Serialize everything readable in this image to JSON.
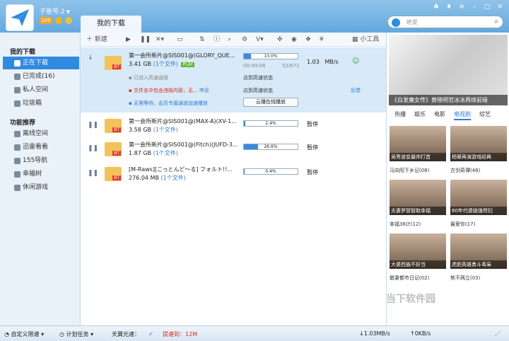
{
  "account": {
    "name": "子账号:2",
    "level": "LV5"
  },
  "tab_title": "我的下载",
  "search": {
    "placeholder": "绝爱"
  },
  "sidebar": {
    "section1": "我的下载",
    "items": [
      {
        "label": "正在下载"
      },
      {
        "label": "已完成(16)"
      },
      {
        "label": "私人空间"
      },
      {
        "label": "垃圾箱"
      }
    ],
    "section2": "功能推荐",
    "features": [
      {
        "label": "离线空间"
      },
      {
        "label": "迅雷看看"
      },
      {
        "label": "155导航"
      },
      {
        "label": "幸福树"
      },
      {
        "label": "休闲游戏"
      }
    ]
  },
  "toolbar": {
    "new_label": "新建",
    "tools_label": "小工具"
  },
  "downloads": [
    {
      "name": "第一会所新片@SIS001@(GLORY_QUE...",
      "size": "3.41 GB",
      "files": "(1个文件)",
      "progress_text": "13.0%",
      "progress": 0.13,
      "speed": "1.03",
      "speed_unit": "MB/s",
      "time": "00:49:08",
      "peers": "52/671"
    },
    {
      "name": "第一会所新片@SIS001@(MAX-A)(XV-1...",
      "size": "3.58 GB",
      "files": "(1个文件)",
      "progress_text": "2.4%",
      "progress": 0.024,
      "status": "暂停"
    },
    {
      "name": "第一会所新片@SIS001@(Fitch)(JUFD-3...",
      "size": "1.87 GB",
      "files": "(1个文件)",
      "progress_text": "26.6%",
      "progress": 0.266,
      "status": "暂停"
    },
    {
      "name": "[M-Raws][こっとんど～る] フォルト!!...",
      "size": "276.04 MB",
      "files": "(1个文件)",
      "progress_text": "0.4%",
      "progress": 0.004,
      "status": "暂停"
    }
  ],
  "details": {
    "line1": "已进入高速通道",
    "line1_status": "达到高速状态",
    "line2": "文件名中包含违规内容，无...",
    "line2_link": "申诉",
    "line2_status": "达到高速状态",
    "line3": "无需等待，会员专属通道加速播放",
    "cloud_button": "云播在线播放",
    "play": "PLAY",
    "feedback": "反馈"
  },
  "right_panel": {
    "poster_title": "《白发魔女传》黄晓明范冰冰再续前缘",
    "tabs": [
      "热播",
      "娱乐",
      "电影",
      "电视剧",
      "综艺"
    ],
    "videos": [
      {
        "caption": "吴秀波变最帅打首",
        "label": "马向阳下乡记(08)"
      },
      {
        "caption": "杨幂再演游戏经典",
        "label": "古剑奇谭(48)"
      },
      {
        "caption": "夫妻罗冒智取幸福",
        "label": "幸福36计(12)"
      },
      {
        "caption": "80年代婆媳强悍妇",
        "label": "最爱你(17)"
      },
      {
        "caption": "大婆西施不好当",
        "label": "憨妻都市日记(02)"
      },
      {
        "caption": "虎胆英雄勇斗毒枭",
        "label": "势不两立(03)"
      }
    ]
  },
  "statusbar": {
    "limit": "自定义限速",
    "plan": "计划任务",
    "tianyi": "天翼光速：",
    "boost": "提速到：12M",
    "down_speed": "1.03MB/s",
    "up_speed": "0KB/s"
  },
  "watermark": "当下软件园"
}
